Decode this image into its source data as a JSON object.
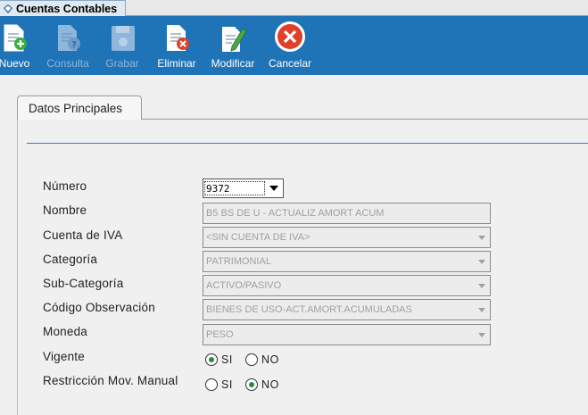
{
  "window": {
    "tab_title": "Cuentas Contables"
  },
  "toolbar": {
    "nuevo": "Nuevo",
    "consulta": "Consulta",
    "grabar": "Grabar",
    "eliminar": "Eliminar",
    "modificar": "Modificar",
    "cancelar": "Cancelar"
  },
  "form": {
    "tab_label": "Datos Principales",
    "labels": {
      "numero": "Número",
      "nombre": "Nombre",
      "cuenta_iva": "Cuenta de IVA",
      "categoria": "Categoría",
      "subcategoria": "Sub-Categoría",
      "codigo_obs": "Código Observación",
      "moneda": "Moneda",
      "vigente": "Vigente",
      "restriccion": "Restricción Mov. Manual"
    },
    "values": {
      "numero": "9372",
      "nombre": "B5 BS DE U - ACTUALIZ AMORT ACUM",
      "cuenta_iva": "<SIN CUENTA DE IVA>",
      "categoria": "PATRIMONIAL",
      "subcategoria": "ACTIVO/PASIVO",
      "codigo_obs": "BIENES DE USO-ACT.AMORT.ACUMULADAS",
      "moneda": "PESO"
    },
    "radio": {
      "si": "SI",
      "no": "NO"
    },
    "vigente_selected": "SI",
    "restriccion_selected": "NO"
  },
  "colors": {
    "toolbar_bg": "#1f73b7",
    "accent_line": "#3a78b5",
    "radio_selected": "#2a8a3a"
  }
}
